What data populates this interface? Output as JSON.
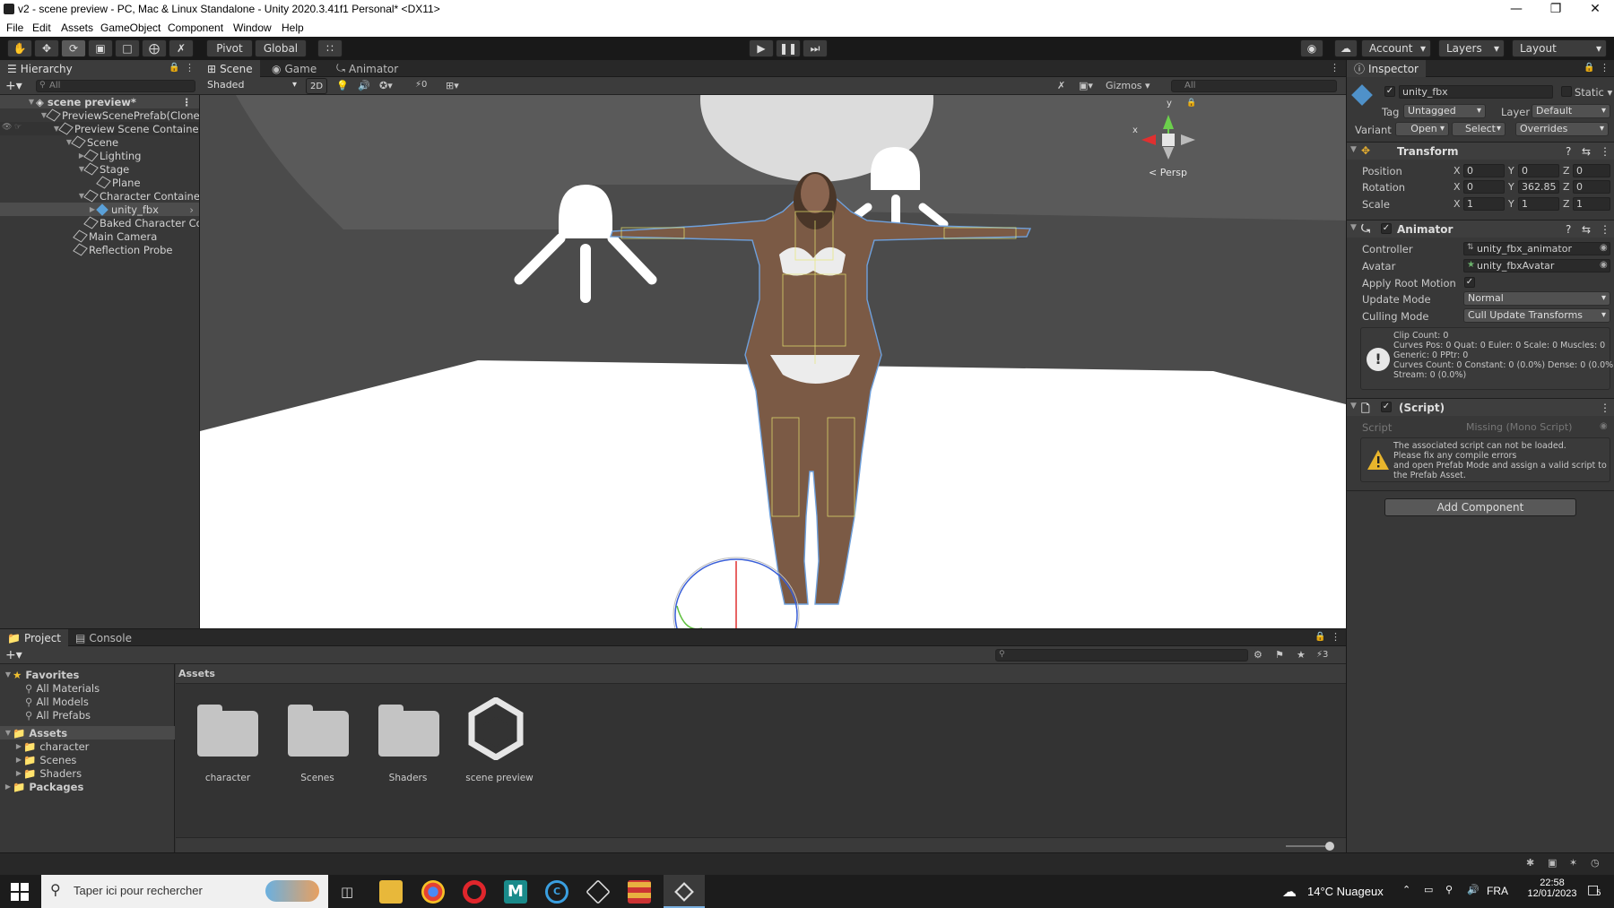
{
  "window": {
    "title": "v2 - scene preview - PC, Mac & Linux Standalone - Unity 2020.3.41f1 Personal* <DX11>"
  },
  "menu": [
    "File",
    "Edit",
    "Assets",
    "GameObject",
    "Component",
    "Window",
    "Help"
  ],
  "toolbar": {
    "pivot": "Pivot",
    "global": "Global",
    "account": "Account",
    "layers": "Layers",
    "layout": "Layout"
  },
  "hierarchy": {
    "tab": "Hierarchy",
    "search_placeholder": "All",
    "items": [
      {
        "label": "scene preview*"
      },
      {
        "label": "PreviewScenePrefab(Clone)"
      },
      {
        "label": "Preview Scene Container"
      },
      {
        "label": "Scene"
      },
      {
        "label": "Lighting"
      },
      {
        "label": "Stage"
      },
      {
        "label": "Plane"
      },
      {
        "label": "Character Container"
      },
      {
        "label": "unity_fbx"
      },
      {
        "label": "Baked Character Co"
      },
      {
        "label": "Main Camera"
      },
      {
        "label": "Reflection Probe"
      }
    ]
  },
  "scene": {
    "tabs": [
      "Scene",
      "Game",
      "Animator"
    ],
    "shading": "Shaded",
    "mode_2d": "2D",
    "hidden_count": "0",
    "gizmos": "Gizmos",
    "search_placeholder": "All",
    "persp": "< Persp",
    "axis_x": "x",
    "axis_y": "y"
  },
  "inspector": {
    "tab": "Inspector",
    "object_name": "unity_fbx",
    "static": "Static",
    "tag_label": "Tag",
    "tag": "Untagged",
    "layer_label": "Layer",
    "layer": "Default",
    "variant_label": "Variant",
    "open": "Open",
    "select": "Select",
    "overrides": "Overrides",
    "transform": {
      "title": "Transform",
      "position_label": "Position",
      "position": {
        "x": "0",
        "y": "0",
        "z": "0"
      },
      "rotation_label": "Rotation",
      "rotation": {
        "x": "0",
        "y": "362.85",
        "z": "0"
      },
      "scale_label": "Scale",
      "scale": {
        "x": "1",
        "y": "1",
        "z": "1"
      },
      "x": "X",
      "y": "Y",
      "z": "Z"
    },
    "animator": {
      "title": "Animator",
      "controller_label": "Controller",
      "controller": "unity_fbx_animator",
      "avatar_label": "Avatar",
      "avatar": "unity_fbxAvatar",
      "apply_root_motion_label": "Apply Root Motion",
      "update_mode_label": "Update Mode",
      "update_mode": "Normal",
      "culling_mode_label": "Culling Mode",
      "culling_mode": "Cull Update Transforms",
      "info_lines": [
        "Clip Count: 0",
        "Curves Pos: 0 Quat: 0 Euler: 0 Scale: 0 Muscles: 0",
        "Generic: 0 PPtr: 0",
        "Curves Count: 0 Constant: 0 (0.0%) Dense: 0 (0.0%)",
        "Stream: 0 (0.0%)"
      ]
    },
    "script": {
      "title": "(Script)",
      "script_label": "Script",
      "script_value": "Missing (Mono Script)",
      "warning_lines": [
        "The associated script can not be loaded.",
        "Please fix any compile errors",
        "and open Prefab Mode and assign a valid script to",
        "the Prefab Asset."
      ]
    },
    "add_component": "Add Component"
  },
  "project": {
    "tabs": [
      "Project",
      "Console"
    ],
    "hidden_count": "3",
    "favorites": "Favorites",
    "fav_items": [
      "All Materials",
      "All Models",
      "All Prefabs"
    ],
    "assets_root": "Assets",
    "asset_folders": [
      "character",
      "Scenes",
      "Shaders"
    ],
    "packages": "Packages",
    "breadcrumb": "Assets",
    "grid_items": [
      "character",
      "Scenes",
      "Shaders",
      "scene preview"
    ]
  },
  "taskbar": {
    "search_placeholder": "Taper ici pour rechercher",
    "weather": "14°C  Nuageux",
    "lang": "FRA",
    "time": "22:58",
    "date": "12/01/2023",
    "notifications": "5"
  },
  "colors": {
    "unity_dark": "#383838",
    "scene_bg": "#4a4a4a",
    "floor": "#ffffff",
    "selection": "#2c5d87",
    "accent_blue": "#3a79bb"
  }
}
